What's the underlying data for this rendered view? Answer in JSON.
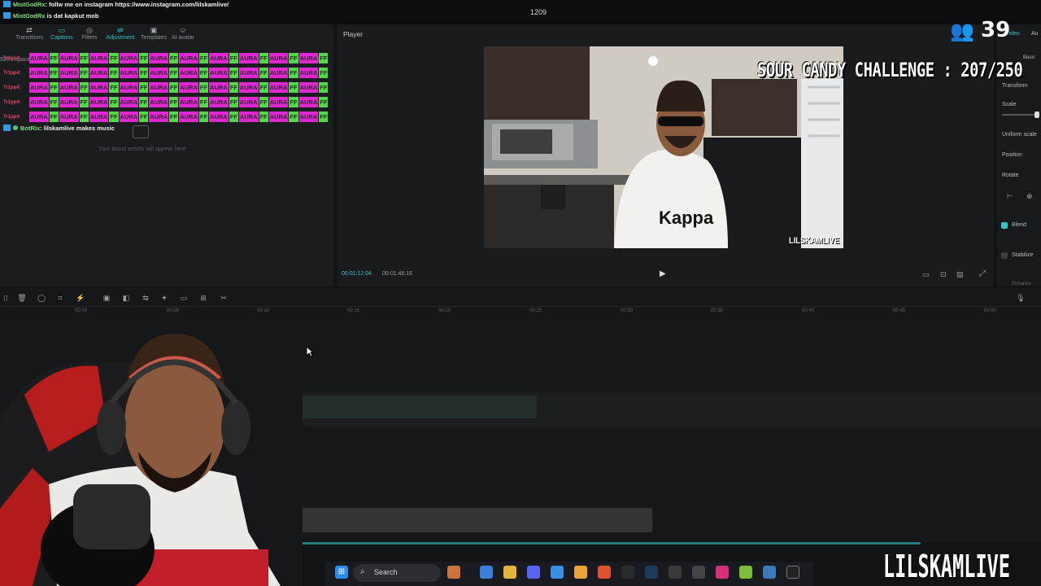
{
  "topbar": {
    "counter": "1209"
  },
  "chat": {
    "lines": [
      {
        "user": "MistGodRx",
        "text": ": follw me on instagram https://www.instagram.com/lilskamlive/"
      },
      {
        "user": "MistGodRx",
        "text": " is dat kapkut mob"
      },
      {
        "user": "BotRix",
        "text": ": lilskamlive makes music"
      }
    ],
    "spam_user": "Tr1pp4",
    "emotes": [
      "AURA",
      "FF",
      "AURA",
      "FF",
      "AURA",
      "FF",
      "AURA",
      "FF",
      "AURA",
      "FF",
      "AURA",
      "FF",
      "AURA",
      "FF",
      "AURA",
      "FF",
      "AURA",
      "FF",
      "AURA",
      "FF"
    ]
  },
  "left_panel": {
    "tabs": [
      "Transitions",
      "Captions",
      "Filters",
      "Adjustment",
      "Templates",
      "AI avatar"
    ],
    "sub_label": "936's space",
    "empty_text": "Your brand assets will appear here"
  },
  "player": {
    "title": "Player",
    "time_current": "00:01:12:04",
    "time_total": "00:01:46:16",
    "video_watermark": "LILSKAMLIVE"
  },
  "right_panel": {
    "tab_video": "Video",
    "tab_audio": "Au",
    "basic": "Basic",
    "transform": "Transform",
    "scale": "Scale",
    "uniform_scale": "Uniform scale",
    "position": "Position",
    "rotate": "Rotate",
    "blend": "Blend",
    "stabilize": "Stabilize",
    "enhance": "Enhance"
  },
  "timeline": {
    "ticks": [
      "00:00",
      "00:05",
      "00:10",
      "00:15",
      "00:20",
      "00:25",
      "00:30",
      "00:35",
      "00:40",
      "00:45",
      "00:50"
    ]
  },
  "taskbar": {
    "search_label": "Search"
  },
  "overlay": {
    "viewer_count": "39",
    "challenge": "SOUR CANDY CHALLENGE : 207/250",
    "brand": "LILSKAMLIVE"
  },
  "colors": {
    "accent": "#2ec3c9",
    "emote_aura": "#e028d1",
    "emote_ff": "#53d84a"
  }
}
